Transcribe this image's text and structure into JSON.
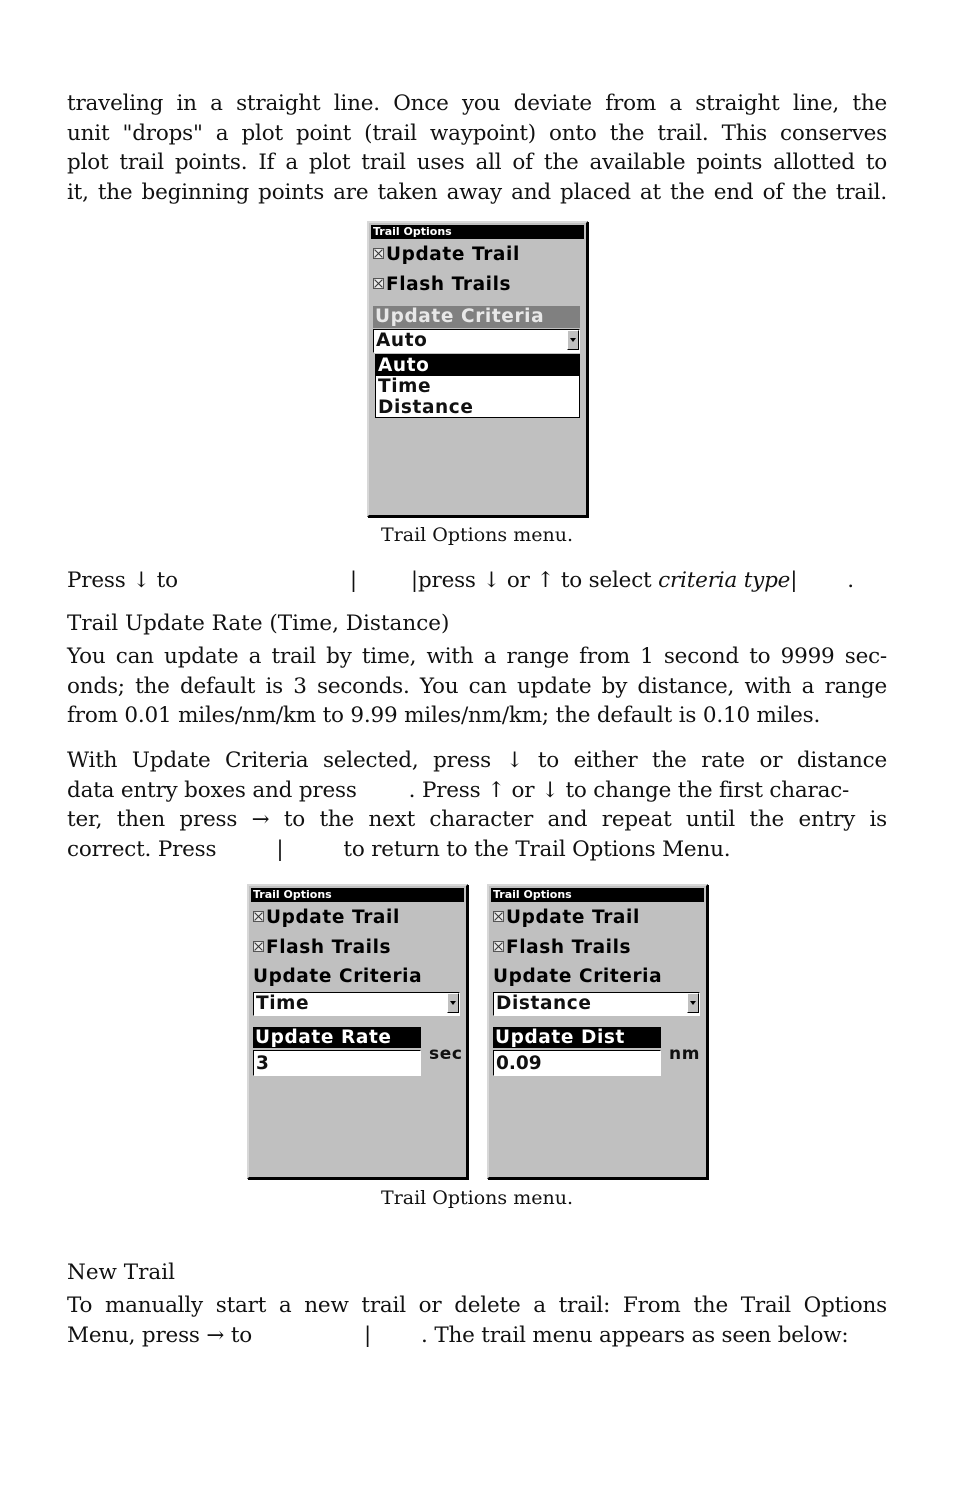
{
  "intro_paragraph": {
    "lines": [
      "traveling in a straight line. Once you deviate from a straight line, the",
      "unit \"drops\" a plot point (trail waypoint) onto the trail. This conserves",
      "plot trail points. If a plot trail uses all of the available points allotted to",
      "it, the beginning points are taken away and placed at the end of the trail."
    ]
  },
  "figure1": {
    "screen": {
      "title": "Trail Options",
      "checkboxes": [
        {
          "label": "Update Trail",
          "checked": true
        },
        {
          "label": "Flash Trails",
          "checked": true
        }
      ],
      "criteria_label": "Update Criteria",
      "criteria_value": "Auto",
      "dropdown_options": [
        {
          "label": "Auto",
          "selected": true
        },
        {
          "label": "Time",
          "selected": false
        },
        {
          "label": "Distance",
          "selected": false
        }
      ]
    },
    "caption": "Trail Options menu."
  },
  "instruction1": {
    "press": "Press",
    "down_arrow": "↓",
    "to": "to",
    "sep": "|",
    "part2": "press",
    "or": "or",
    "up_arrow": "↑",
    "part3": "to select",
    "italic": "criteria type",
    "end": "."
  },
  "section_rate": {
    "heading": "Trail Update Rate (Time, Distance)",
    "lines": [
      "You can update a trail by time, with a range from 1 second to 9999 sec-",
      "onds; the default is 3 seconds. You can update by distance, with a range",
      "from 0.01 miles/nm/km to 9.99 miles/nm/km; the default is 0.10 miles."
    ]
  },
  "section_entry": {
    "line1": "With Update Criteria selected, press ↓ to either the rate or distance",
    "line2a": "data entry boxes and press",
    "line2b": ". Press ↑ or ↓ to change the first charac-",
    "line3": "ter, then press → to the next character and repeat until the entry is",
    "line4a": "correct. Press",
    "line4sep": "|",
    "line4b": "to return to the Trail Options Menu."
  },
  "figure2": {
    "screens": [
      {
        "title": "Trail Options",
        "checkboxes": [
          {
            "label": "Update Trail",
            "checked": true
          },
          {
            "label": "Flash Trails",
            "checked": true
          }
        ],
        "criteria_label": "Update Criteria",
        "criteria_value": "Time",
        "field_label": "Update Rate",
        "field_value": "3",
        "unit": "sec"
      },
      {
        "title": "Trail Options",
        "checkboxes": [
          {
            "label": "Update Trail",
            "checked": true
          },
          {
            "label": "Flash Trails",
            "checked": true
          }
        ],
        "criteria_label": "Update Criteria",
        "criteria_value": "Distance",
        "field_label": "Update Dist",
        "field_value": "0.09",
        "unit": "nm"
      }
    ],
    "caption": "Trail Options menu."
  },
  "section_new_trail": {
    "heading": "New Trail",
    "line1": "To manually start a new trail or delete a trail: From the Trail Options",
    "line2a": "Menu, press → to",
    "line2sep": "|",
    "line2b": ". The trail menu appears as seen below:"
  }
}
